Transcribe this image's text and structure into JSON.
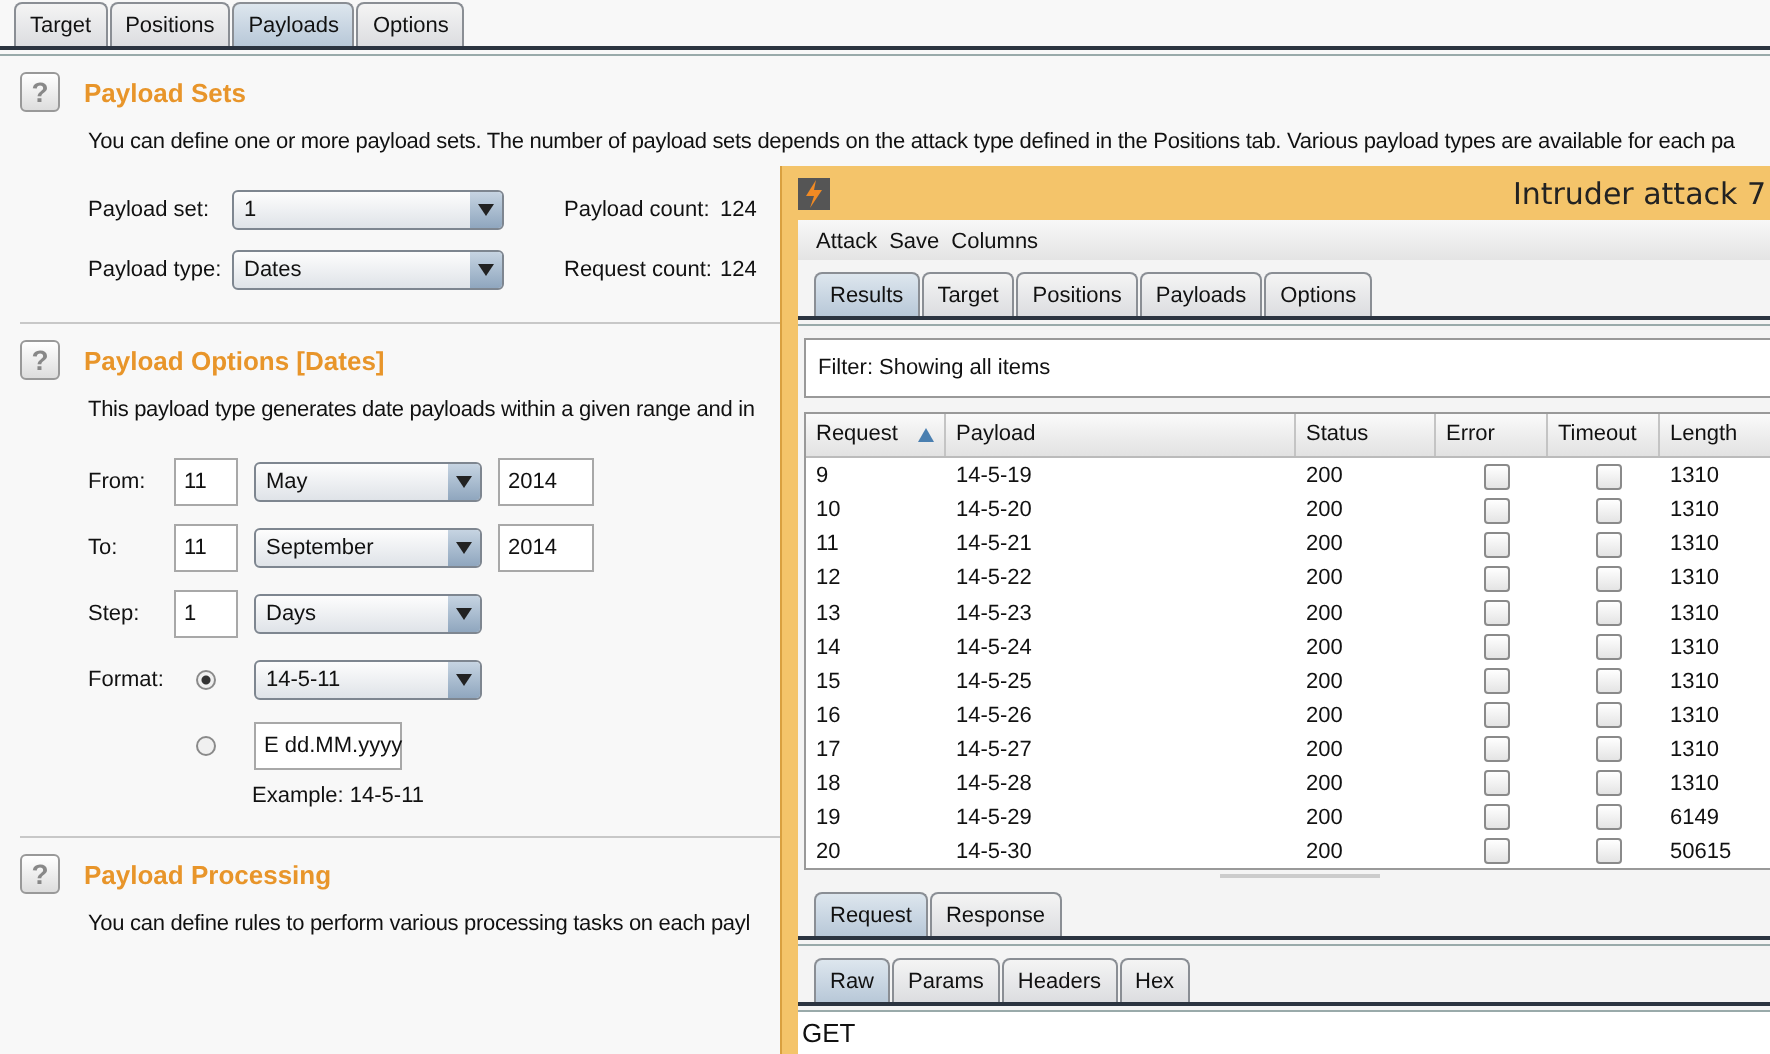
{
  "tabs": [
    {
      "label": "Target",
      "selected": false
    },
    {
      "label": "Positions",
      "selected": false
    },
    {
      "label": "Payloads",
      "selected": true
    },
    {
      "label": "Options",
      "selected": false
    }
  ],
  "payload_sets": {
    "help": "?",
    "title": "Payload Sets",
    "description": "You can define one or more payload sets. The number of payload sets depends on the attack type defined in the Positions tab. Various payload types are available for each pa",
    "fields": [
      {
        "label": "Payload set:",
        "value": "1",
        "count_label": "Payload count:",
        "count": "124"
      },
      {
        "label": "Payload type:",
        "value": "Dates",
        "count_label": "Request count:",
        "count": "124"
      }
    ]
  },
  "payload_options": {
    "help": "?",
    "title": "Payload Options [Dates]",
    "description": "This payload type generates date payloads within a given range and in",
    "rows": [
      {
        "kind": "date",
        "label": "From:",
        "day": "11",
        "month": "May",
        "year": "2014"
      },
      {
        "kind": "date",
        "label": "To:",
        "day": "11",
        "month": "September",
        "year": "2014"
      },
      {
        "kind": "step",
        "label": "Step:",
        "value": "1",
        "unit": "Days"
      },
      {
        "kind": "radio-select",
        "label": "Format:",
        "selected": true,
        "value": "14-5-11"
      },
      {
        "kind": "radio-field",
        "selected": false,
        "value": "E dd.MM.yyyy"
      },
      {
        "kind": "note",
        "text": "Example:  14-5-11"
      }
    ]
  },
  "payload_processing": {
    "help": "?",
    "title": "Payload Processing",
    "description": "You can define rules to perform various processing tasks on each payl"
  },
  "attack_window": {
    "title": "Intruder attack 7",
    "menu": [
      "Attack",
      "Save",
      "Columns"
    ],
    "tabs": [
      {
        "label": "Results",
        "selected": true
      },
      {
        "label": "Target",
        "selected": false
      },
      {
        "label": "Positions",
        "selected": false
      },
      {
        "label": "Payloads",
        "selected": false
      },
      {
        "label": "Options",
        "selected": false
      }
    ],
    "filter": "Filter:  Showing all items",
    "table": {
      "columns": [
        {
          "label": "Request",
          "sorted": true
        },
        {
          "label": "Payload",
          "sorted": false
        },
        {
          "label": "Status",
          "sorted": false
        },
        {
          "label": "Error",
          "sorted": false
        },
        {
          "label": "Timeout",
          "sorted": false
        },
        {
          "label": "Length",
          "sorted": false
        }
      ],
      "rows": [
        {
          "request": "9",
          "payload": "14-5-19",
          "status": "200",
          "error": false,
          "timeout": false,
          "length": "1310"
        },
        {
          "request": "10",
          "payload": "14-5-20",
          "status": "200",
          "error": false,
          "timeout": false,
          "length": "1310"
        },
        {
          "request": "11",
          "payload": "14-5-21",
          "status": "200",
          "error": false,
          "timeout": false,
          "length": "1310"
        },
        {
          "request": "12",
          "payload": "14-5-22",
          "status": "200",
          "error": false,
          "timeout": false,
          "length": "1310"
        },
        {
          "request": "13",
          "payload": "14-5-23",
          "status": "200",
          "error": false,
          "timeout": false,
          "length": "1310"
        },
        {
          "request": "14",
          "payload": "14-5-24",
          "status": "200",
          "error": false,
          "timeout": false,
          "length": "1310"
        },
        {
          "request": "15",
          "payload": "14-5-25",
          "status": "200",
          "error": false,
          "timeout": false,
          "length": "1310"
        },
        {
          "request": "16",
          "payload": "14-5-26",
          "status": "200",
          "error": false,
          "timeout": false,
          "length": "1310"
        },
        {
          "request": "17",
          "payload": "14-5-27",
          "status": "200",
          "error": false,
          "timeout": false,
          "length": "1310"
        },
        {
          "request": "18",
          "payload": "14-5-28",
          "status": "200",
          "error": false,
          "timeout": false,
          "length": "1310"
        },
        {
          "request": "19",
          "payload": "14-5-29",
          "status": "200",
          "error": false,
          "timeout": false,
          "length": "6149"
        },
        {
          "request": "20",
          "payload": "14-5-30",
          "status": "200",
          "error": false,
          "timeout": false,
          "length": "50615"
        }
      ]
    },
    "message_tabs": [
      {
        "label": "Request",
        "selected": true
      },
      {
        "label": "Response",
        "selected": false
      }
    ],
    "view_tabs": [
      {
        "label": "Raw",
        "selected": true
      },
      {
        "label": "Params",
        "selected": false
      },
      {
        "label": "Headers",
        "selected": false
      },
      {
        "label": "Hex",
        "selected": false
      }
    ],
    "body": "GET"
  }
}
